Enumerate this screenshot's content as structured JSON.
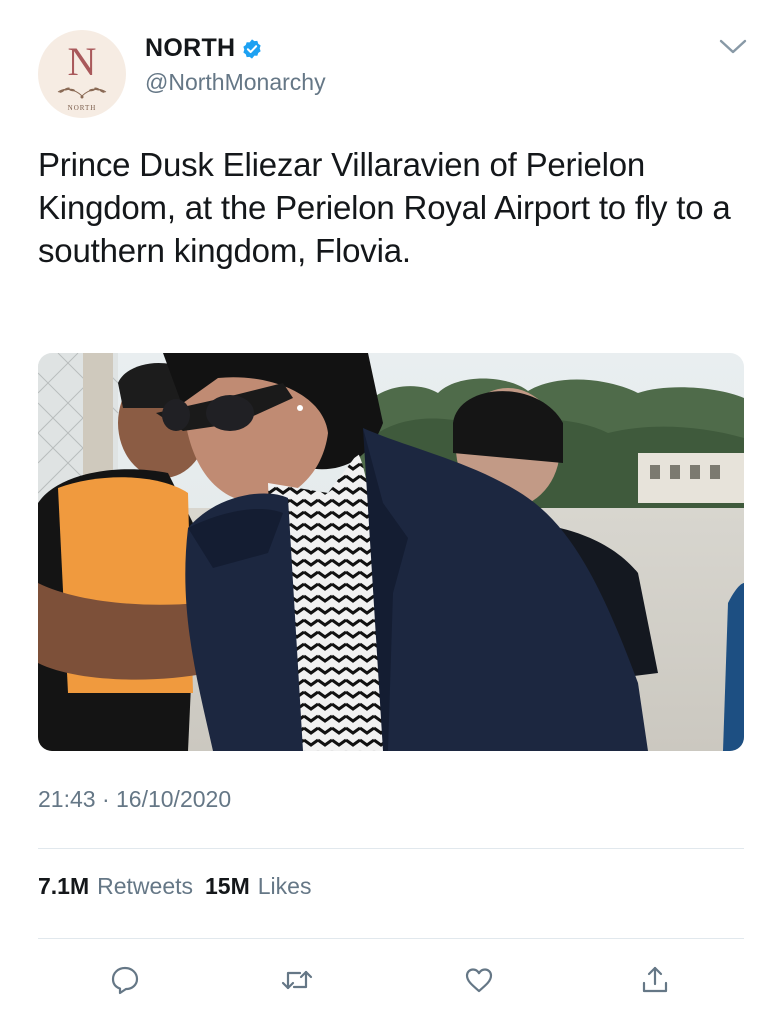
{
  "tweet": {
    "author": {
      "display_name": "NORTH",
      "handle": "@NorthMonarchy",
      "verified": true,
      "avatar": {
        "letter": "N",
        "caption": "NORTH",
        "color": "#a9595b"
      }
    },
    "text": "Prince Dusk Eliezar Villaravien of Perielon Kingdom, at the Perielon Royal Airport to fly to a southern kingdom, Flovia.",
    "timestamp": "21:43 · 16/10/2020",
    "stats": {
      "retweets_count": "7.1M",
      "retweets_label": "Retweets",
      "likes_count": "15M",
      "likes_label": "Likes"
    },
    "actions": [
      "reply-icon",
      "retweet-icon",
      "like-icon",
      "share-icon"
    ]
  },
  "colors": {
    "text": "#14171a",
    "secondary": "#657786",
    "verified": "#1da1f2",
    "divider": "#e1e8ed",
    "accent_avatar": "#a9595b"
  }
}
